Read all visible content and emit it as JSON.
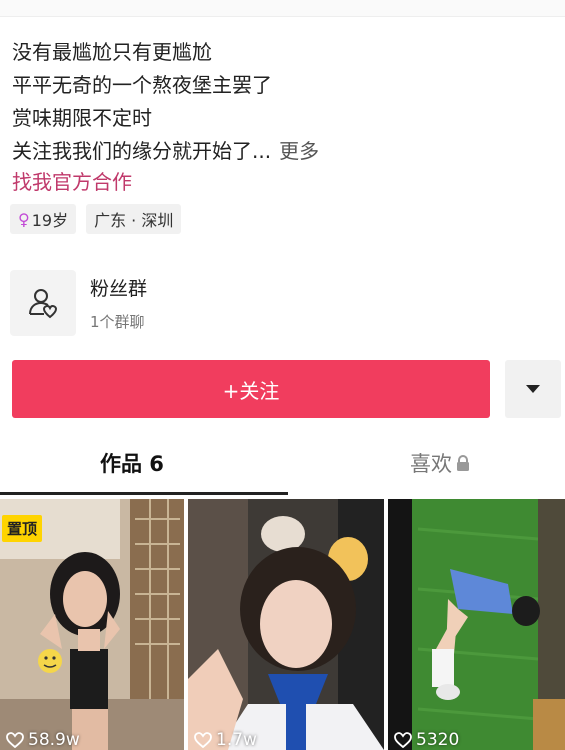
{
  "bio": {
    "lines": [
      "没有最尴尬只有更尴尬",
      "平平无奇的一个熬夜堡主罢了",
      "赏味期限不定时",
      "关注我我们的缘分就开始了..."
    ],
    "more": "更多",
    "link": "找我官方合作"
  },
  "tags": {
    "age": "19岁",
    "location": "广东 · 深圳"
  },
  "fans_group": {
    "title": "粉丝群",
    "subtitle": "1个群聊"
  },
  "actions": {
    "follow": "+关注"
  },
  "tabs": {
    "works": "作品 6",
    "likes": "喜欢"
  },
  "videos": [
    {
      "badge": "置顶",
      "likes": "58.9w"
    },
    {
      "likes": "1.7w"
    },
    {
      "likes": "5320"
    }
  ],
  "colors": {
    "follow": "#f13d5e",
    "link": "#c0396b",
    "pin": "#ffd400"
  }
}
